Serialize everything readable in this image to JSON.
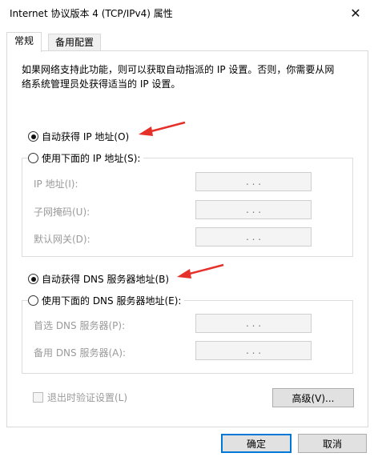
{
  "window": {
    "title": "Internet 协议版本 4 (TCP/IPv4) 属性",
    "close_glyph": "✕"
  },
  "tabs": [
    {
      "label": "常规",
      "active": true
    },
    {
      "label": "备用配置",
      "active": false
    }
  ],
  "general": {
    "description_line1": "如果网络支持此功能，则可以获取自动指派的 IP 设置。否则，你需要从网",
    "description_line2": "络系统管理员处获得适当的 IP 设置。",
    "ip_auto_label": "自动获得 IP 地址(O)",
    "ip_auto_checked": true,
    "ip_manual_label": "使用下面的 IP 地址(S):",
    "ip_manual_checked": false,
    "ip_fields": [
      {
        "label": "IP 地址(I):",
        "value": ".       .       ."
      },
      {
        "label": "子网掩码(U):",
        "value": ".       .       ."
      },
      {
        "label": "默认网关(D):",
        "value": ".       .       ."
      }
    ],
    "dns_auto_label": "自动获得 DNS 服务器地址(B)",
    "dns_auto_checked": true,
    "dns_manual_label": "使用下面的 DNS 服务器地址(E):",
    "dns_manual_checked": false,
    "dns_fields": [
      {
        "label": "首选 DNS 服务器(P):",
        "value": ".       .       ."
      },
      {
        "label": "备用 DNS 服务器(A):",
        "value": ".       .       ."
      }
    ],
    "validate_label": "退出时验证设置(L)",
    "validate_checked": false,
    "advanced_label": "高级(V)..."
  },
  "footer": {
    "ok_label": "确定",
    "cancel_label": "取消"
  },
  "colors": {
    "accent": "#0078d7",
    "arrow": "#e5312a",
    "disabled_text": "#9a9a9a"
  }
}
